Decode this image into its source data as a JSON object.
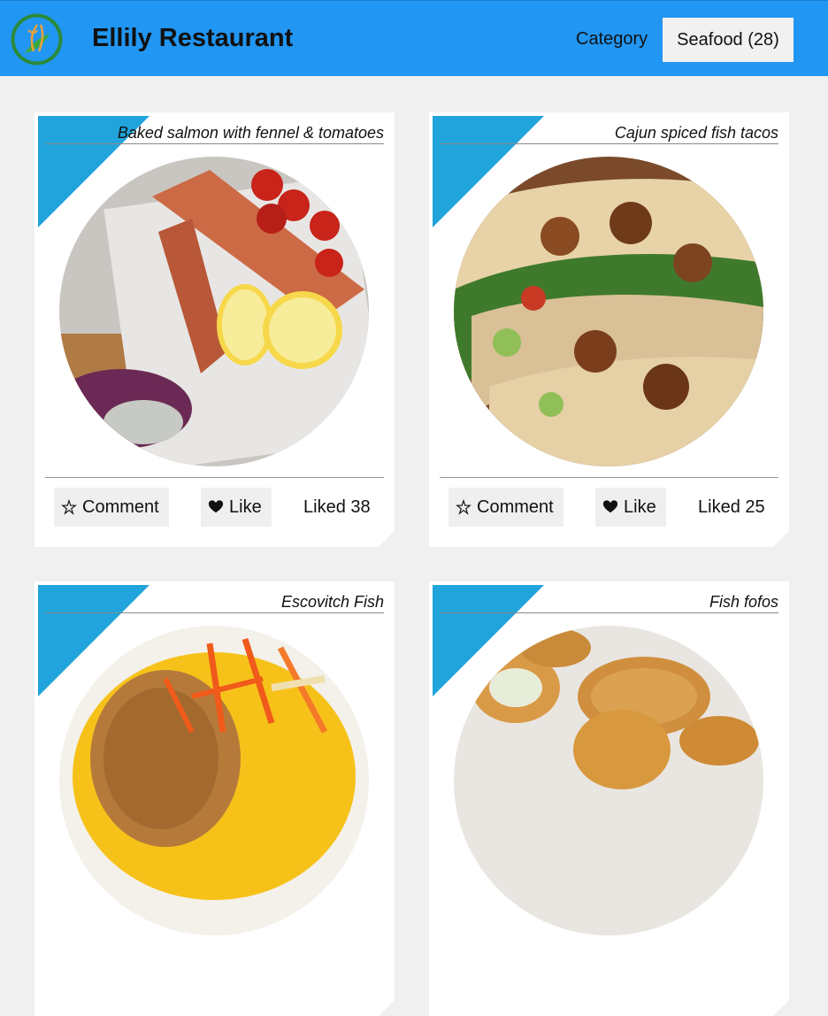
{
  "header": {
    "brand": "Ellily Restaurant",
    "category_label": "Category",
    "category_selected": "Seafood (28)",
    "logo_icon": "leaf-fork-spoon-logo"
  },
  "colors": {
    "header_bg": "#2196f3",
    "accent_triangle": "#21a4dc",
    "page_bg": "#f0f0f0"
  },
  "cards": [
    {
      "title": "Baked salmon with fennel & tomatoes",
      "comment_label": "Comment",
      "like_label": "Like",
      "liked_text": "Liked 38"
    },
    {
      "title": "Cajun spiced fish tacos",
      "comment_label": "Comment",
      "like_label": "Like",
      "liked_text": "Liked 25"
    },
    {
      "title": "Escovitch Fish"
    },
    {
      "title": "Fish fofos"
    }
  ]
}
